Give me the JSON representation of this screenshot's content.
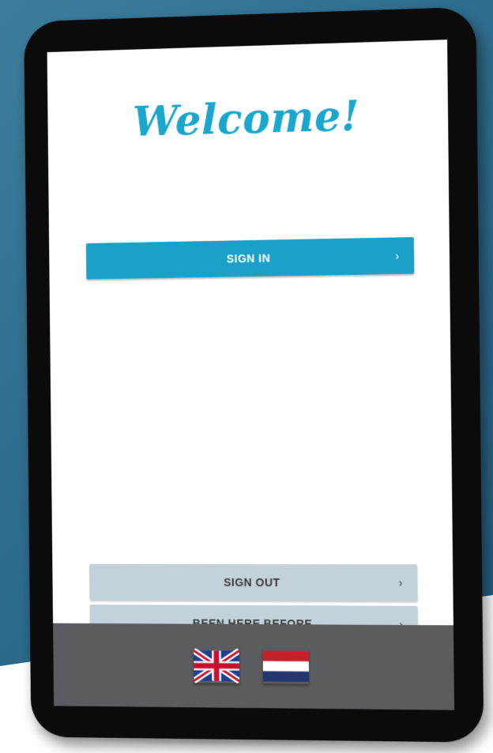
{
  "welcome": {
    "title": "Welcome!"
  },
  "buttons": {
    "sign_in": "SIGN IN",
    "sign_out": "SIGN OUT",
    "been_here_before": "BEEN HERE BEFORE",
    "chevron": "›"
  },
  "languages": [
    {
      "name": "uk-flag-icon"
    },
    {
      "name": "netherlands-flag-icon"
    }
  ],
  "colors": {
    "accent": "#1ba6cb",
    "primary_button": "#1ba0c8",
    "secondary_button": "#c2d1da",
    "footer": "#5b5c60",
    "background": "#2f6f90"
  }
}
